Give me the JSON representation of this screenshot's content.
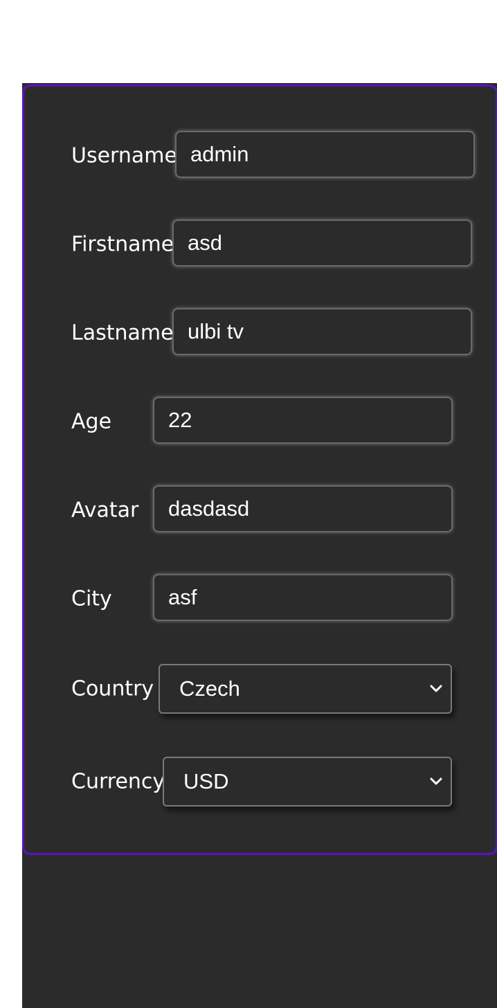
{
  "profile": {
    "fields": {
      "username": {
        "label": "Username",
        "value": "admin"
      },
      "firstname": {
        "label": "Firstname",
        "value": "asd"
      },
      "lastname": {
        "label": "Lastname",
        "value": "ulbi tv"
      },
      "age": {
        "label": "Age",
        "value": "22"
      },
      "avatar": {
        "label": "Avatar",
        "value": "dasdasd"
      },
      "city": {
        "label": "City",
        "value": "asf"
      }
    },
    "country": {
      "label": "Country",
      "selected": "Czech",
      "icon": "chevron-down-icon"
    },
    "currency": {
      "label": "Currency",
      "selected": "USD",
      "icon": "chevron-down-icon"
    }
  },
  "colors": {
    "background": "#2b2b2b",
    "card_border": "#5b10c9",
    "text": "#ffffff"
  }
}
